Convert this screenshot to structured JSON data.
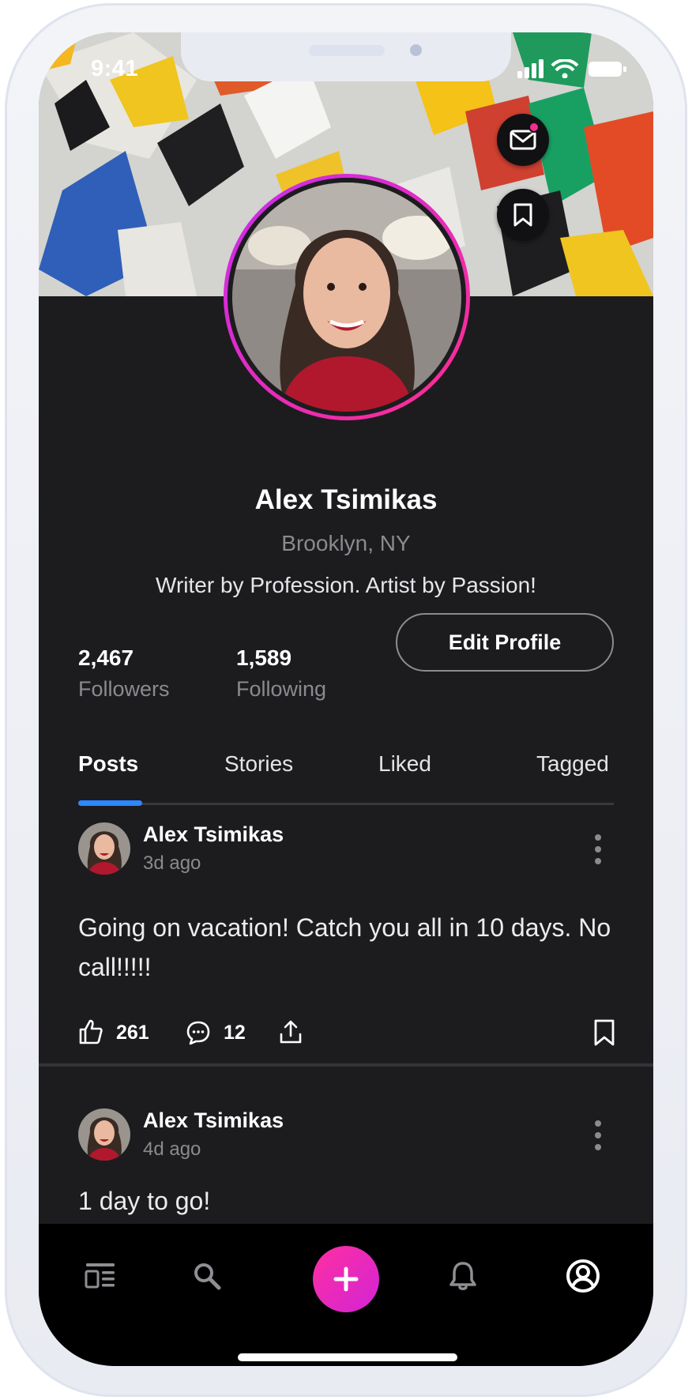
{
  "status": {
    "time": "9:41"
  },
  "profile": {
    "name": "Alex Tsimikas",
    "location": "Brooklyn, NY",
    "bio": "Writer by Profession. Artist by Passion!",
    "followers_count": "2,467",
    "followers_label": "Followers",
    "following_count": "1,589",
    "following_label": "Following",
    "edit_label": "Edit Profile"
  },
  "tabs": [
    {
      "label": "Posts",
      "active": true
    },
    {
      "label": "Stories"
    },
    {
      "label": "Liked"
    },
    {
      "label": "Tagged"
    }
  ],
  "posts": [
    {
      "author": "Alex Tsimikas",
      "time": "3d ago",
      "text": "Going on vacation! Catch you all in 10 days. No call!!!!!",
      "likes": "261",
      "comments": "12"
    },
    {
      "author": "Alex Tsimikas",
      "time": "4d ago",
      "text": "1 day to go!"
    }
  ],
  "icons": {
    "header": [
      "mail-icon",
      "bookmark-icon"
    ],
    "tabbar": [
      "feed-icon",
      "search-icon",
      "plus-icon",
      "bell-icon",
      "profile-icon"
    ]
  },
  "colors": {
    "background": "#1c1c1f",
    "accent_blue": "#2d87ff",
    "accent_pink": "#ff2fa0",
    "notification_dot": "#f22f8e"
  }
}
